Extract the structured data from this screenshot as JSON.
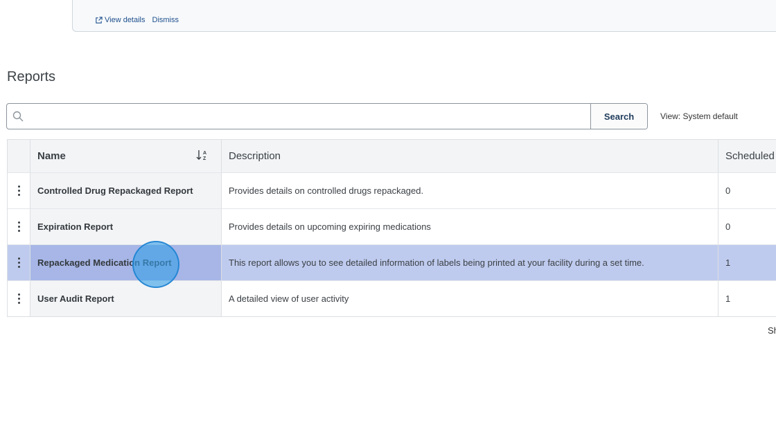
{
  "notice": {
    "view_details": "View details",
    "dismiss": "Dismiss"
  },
  "page_title": "Reports",
  "search": {
    "value": "",
    "placeholder": "",
    "button_label": "Search"
  },
  "view_label": "View: System default",
  "table": {
    "columns": {
      "name": "Name",
      "description": "Description",
      "scheduled": "Scheduled C"
    },
    "rows": [
      {
        "name": "Controlled Drug Repackaged Report",
        "description": "Provides details on controlled drugs repackaged.",
        "scheduled": "0"
      },
      {
        "name": "Expiration Report",
        "description": "Provides details on upcoming expiring medications",
        "scheduled": "0"
      },
      {
        "name": "Repackaged Medication Report",
        "description": "This report allows you to see detailed information of labels being printed at your facility during a set time.",
        "scheduled": "1"
      },
      {
        "name": "User Audit Report",
        "description": "A detailed view of user activity",
        "scheduled": "1"
      }
    ],
    "selected_row_index": 2
  },
  "footer_text": "Sh",
  "icons": {
    "external_link": "external-link-icon",
    "search": "search-icon",
    "sort": "sort-alpha-icon",
    "row_menu": "kebab-menu-icon"
  },
  "colors": {
    "selected_row": "#bfcbee",
    "click_marker": "#38a0e6",
    "link": "#1f4f8c"
  }
}
